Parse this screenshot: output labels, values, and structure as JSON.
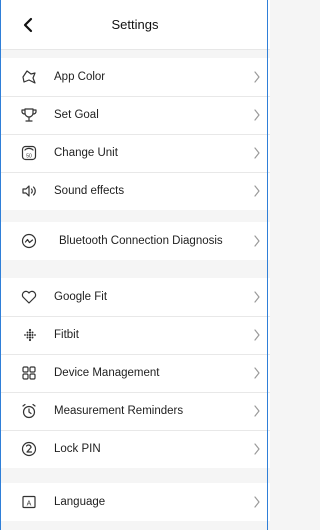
{
  "header": {
    "title": "Settings",
    "back_icon": "chevron-left-icon"
  },
  "sections": [
    {
      "items": [
        {
          "label": "App Color",
          "icon": "palette-icon"
        },
        {
          "label": "Set Goal",
          "icon": "trophy-icon"
        },
        {
          "label": "Change Unit",
          "icon": "scale-icon",
          "icon_text": "50"
        },
        {
          "label": "Sound effects",
          "icon": "speaker-icon"
        }
      ]
    },
    {
      "items": [
        {
          "label": "Bluetooth Connection Diagnosis",
          "icon": "diagnosis-icon"
        }
      ]
    },
    {
      "items": [
        {
          "label": "Google Fit",
          "icon": "heart-icon"
        },
        {
          "label": "Fitbit",
          "icon": "fitbit-dots-icon"
        },
        {
          "label": "Device Management",
          "icon": "grid-icon"
        },
        {
          "label": "Measurement Reminders",
          "icon": "alarm-clock-icon"
        },
        {
          "label": "Lock PIN",
          "icon": "lock-pin-icon"
        }
      ]
    },
    {
      "items": [
        {
          "label": "Language",
          "icon": "language-icon",
          "icon_text": "A"
        }
      ]
    }
  ],
  "colors": {
    "background": "#f5f5f5",
    "row_background": "#ffffff",
    "frame_border": "#2f7fd8",
    "chevron": "#9a9a9a"
  }
}
